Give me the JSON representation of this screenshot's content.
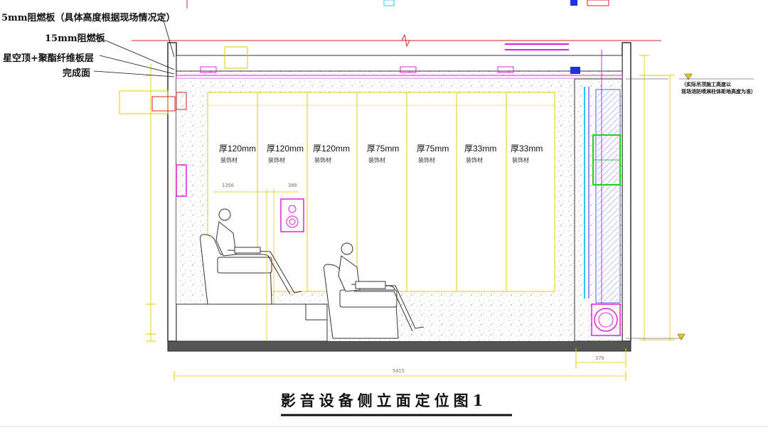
{
  "labels": {
    "board_5mm": "5mm阻燃板（具体高度根据现场情况定）",
    "board_15mm": "15mm阻燃板",
    "starry_ceiling": "星空顶+聚酯纤维板层",
    "finish_face": "完成面"
  },
  "right_note": {
    "line1": "（实际吊顶施工高度以",
    "line2": "现场消防喷淋柱体距地高度为准）"
  },
  "panels": [
    {
      "thickness": "厚120mm",
      "material": "装饰材"
    },
    {
      "thickness": "厚120mm",
      "material": "装饰材"
    },
    {
      "thickness": "厚120mm",
      "material": "装饰材"
    },
    {
      "thickness": "厚75mm",
      "material": "装饰材"
    },
    {
      "thickness": "厚75mm",
      "material": "装饰材"
    },
    {
      "thickness": "厚33mm",
      "material": "装饰材"
    },
    {
      "thickness": "厚33mm",
      "material": "装饰材"
    }
  ],
  "dimensions": {
    "total_width": "5415",
    "right_width": "370",
    "seat_height": "1350",
    "speaker_width": "300"
  },
  "title": "影音设备侧立面定位图1",
  "colors": {
    "magenta": "#e020e0",
    "yellow": "#e8c800",
    "red": "#e02020",
    "green": "#20d020",
    "cyan": "#30c8e8",
    "blue": "#2030e0"
  }
}
